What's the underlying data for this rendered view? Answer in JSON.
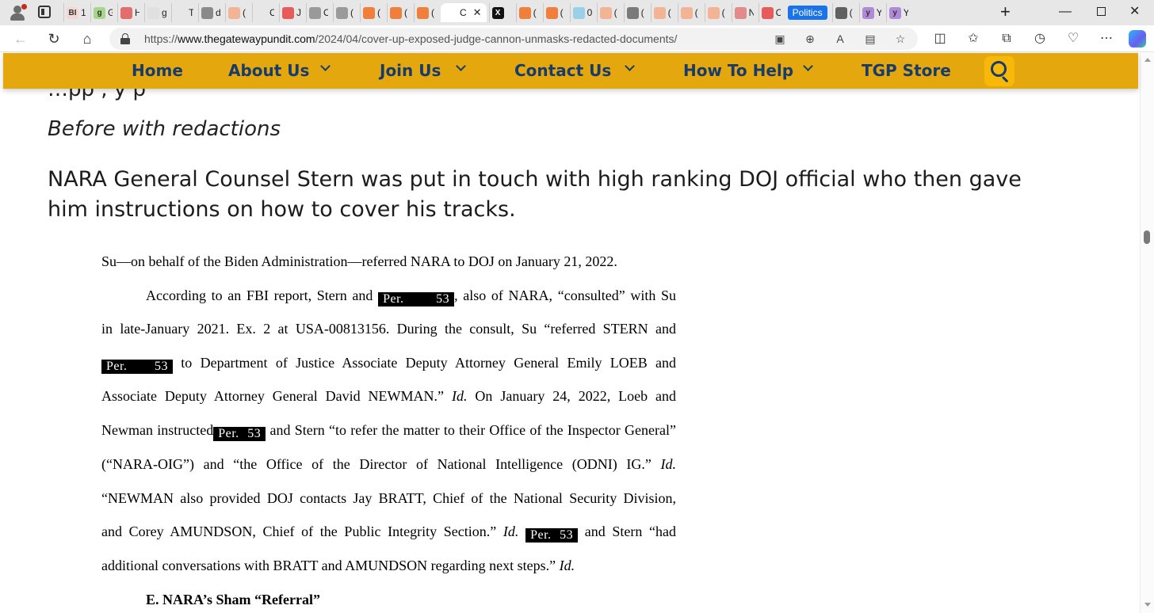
{
  "browser": {
    "tabs": [
      {
        "title": "1",
        "favicon_text": "BI",
        "favicon_color": "#f4d7d3"
      },
      {
        "title": "G",
        "favicon_text": "g",
        "favicon_color": "#a6d68a"
      },
      {
        "title": "H",
        "favicon_text": "",
        "favicon_color": "#e36d6d"
      },
      {
        "title": "g",
        "favicon_text": "",
        "favicon_color": "#e0e0e0"
      },
      {
        "title": "T",
        "favicon_text": "",
        "favicon_color": "#e7e7e7"
      },
      {
        "title": "d",
        "favicon_text": "",
        "favicon_color": "#8a8a8a"
      },
      {
        "title": "(",
        "favicon_text": "",
        "favicon_color": "#f3b395"
      },
      {
        "title": "C",
        "favicon_text": "",
        "favicon_color": "#e7e7e7"
      },
      {
        "title": "J",
        "favicon_text": "",
        "favicon_color": "#e85b5b"
      },
      {
        "title": "C",
        "favicon_text": "",
        "favicon_color": "#9a9a9a"
      },
      {
        "title": "(",
        "favicon_text": "",
        "favicon_color": "#9a9a9a"
      },
      {
        "title": "(",
        "favicon_text": "",
        "favicon_color": "#f07f3c"
      },
      {
        "title": "(",
        "favicon_text": "",
        "favicon_color": "#f07f3c"
      },
      {
        "title": "(",
        "favicon_text": "",
        "favicon_color": "#f07f3c"
      },
      {
        "title": "C",
        "favicon_text": "",
        "favicon_color": "#ffffff",
        "active": true
      },
      {
        "title": "",
        "favicon_text": "X",
        "favicon_color": "#111111"
      },
      {
        "title": "(",
        "favicon_text": "",
        "favicon_color": "#f07f3c"
      },
      {
        "title": "(",
        "favicon_text": "",
        "favicon_color": "#f07f3c"
      },
      {
        "title": "0",
        "favicon_text": "",
        "favicon_color": "#9ad0e8"
      },
      {
        "title": "(",
        "favicon_text": "",
        "favicon_color": "#f3b395"
      },
      {
        "title": "(",
        "favicon_text": "",
        "favicon_color": "#7a7a7a"
      },
      {
        "title": "(",
        "favicon_text": "",
        "favicon_color": "#f3b395"
      },
      {
        "title": "(",
        "favicon_text": "",
        "favicon_color": "#f3b395"
      },
      {
        "title": "(",
        "favicon_text": "",
        "favicon_color": "#f3b395"
      },
      {
        "title": "N",
        "favicon_text": "",
        "favicon_color": "#e38a8a"
      },
      {
        "title": "C",
        "favicon_text": "",
        "favicon_color": "#e85b5b"
      }
    ],
    "tab_group_label": "Politics",
    "group_tabs": [
      {
        "title": "(",
        "favicon_text": "",
        "favicon_color": "#606060"
      },
      {
        "title": "Y",
        "favicon_text": "y",
        "favicon_color": "#b08ad8"
      },
      {
        "title": "Y",
        "favicon_text": "y",
        "favicon_color": "#b08ad8"
      }
    ],
    "url_prefix": "https://",
    "url_host": "www.thegatewaypundit.com",
    "url_path": "/2024/04/cover-up-exposed-judge-cannon-unmasks-redacted-documents/"
  },
  "site_nav": {
    "home": "Home",
    "about": "About Us",
    "join": "Join Us",
    "contact": "Contact Us",
    "help": "How To Help",
    "store": "TGP Store"
  },
  "article": {
    "partial_line": "…pp   ,                                    y   p",
    "caption": "Before with redactions",
    "lede": "NARA General Counsel Stern was put in touch with high ranking DOJ official who then gave him instructions on how to cover his tracks.",
    "document": {
      "redaction_label": "Per. 53",
      "line1": "Su—on behalf of the Biden Administration—referred NARA to DOJ on January 21, 2022.",
      "line2_a": "According to an FBI report, Stern and",
      "line2_b": ", also of NARA, “consulted” with Su",
      "line3": "in late-January 2021. Ex. 2 at USA-00813156.  During the consult, Su “referred STERN and",
      "line4_b": "to Department of Justice Associate Deputy Attorney General Emily LOEB and",
      "line5_a": "Associate Deputy Attorney General David NEWMAN.”",
      "id": "Id.",
      "line5_b": "On January 24, 2022, Loeb and",
      "line6_a": "Newman instructed",
      "line6_b": "and Stern “to refer the matter to their Office of the Inspector General”",
      "line7_a": "(“NARA-OIG”) and “the Office of the Director of National Intelligence (ODNI) IG.”",
      "line8": "“NEWMAN also provided DOJ contacts Jay BRATT, Chief of the National Security Division,",
      "line9_a": "and Corey AMUNDSON, Chief of the Public Integrity Section.”",
      "line9_b": "and Stern “had",
      "line10_a": "additional conversations with BRATT and AMUNDSON regarding next steps.”",
      "heading": "E.   NARA’s Sham “Referral”"
    }
  },
  "colors": {
    "nav_bg": "#e5a70e",
    "nav_text": "#173c6b",
    "search_bg": "#f8b808"
  }
}
